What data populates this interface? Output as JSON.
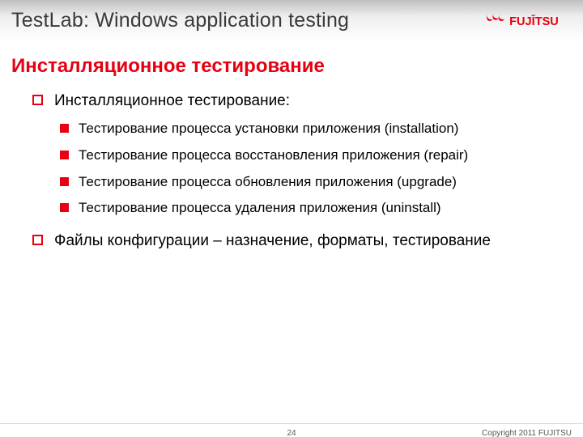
{
  "header": {
    "title": "TestLab: Windows application testing",
    "logo_text": "FUJITSU"
  },
  "subtitle": "Инсталляционное тестирование",
  "items": [
    {
      "level": 1,
      "text": "Инсталляционное тестирование:"
    },
    {
      "level": 2,
      "text": "Тестирование процесса установки приложения (installation)"
    },
    {
      "level": 2,
      "text": "Тестирование процесса восстановления приложения (repair)"
    },
    {
      "level": 2,
      "text": "Тестирование процесса обновления приложения (upgrade)"
    },
    {
      "level": 2,
      "text": "Тестирование процесса удаления приложения (uninstall)"
    },
    {
      "level": 1,
      "text": "Файлы конфигурации – назначение, форматы, тестирование"
    }
  ],
  "footer": {
    "page": "24",
    "copyright": "Copyright 2011 FUJITSU"
  },
  "colors": {
    "accent": "#E60012"
  }
}
